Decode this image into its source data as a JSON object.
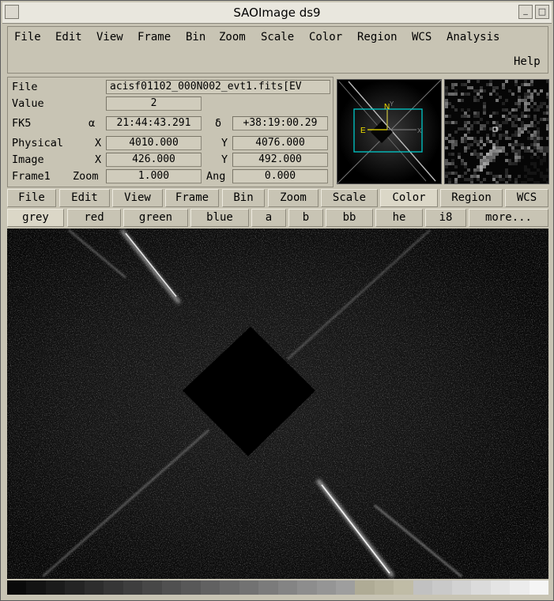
{
  "window": {
    "title": "SAOImage ds9",
    "buttons": {
      "minimize": "_",
      "maximize": "□",
      "close": "✕"
    }
  },
  "menubar": {
    "items": [
      "File",
      "Edit",
      "View",
      "Frame",
      "Bin",
      "Zoom",
      "Scale",
      "Color",
      "Region",
      "WCS",
      "Analysis"
    ],
    "help": "Help"
  },
  "info": {
    "file_label": "File",
    "file_value": "acisf01102_000N002_evt1.fits[EV",
    "value_label": "Value",
    "value_value": "2",
    "fk5_label": "FK5",
    "alpha_symbol": "α",
    "alpha_value": "21:44:43.291",
    "delta_symbol": "δ",
    "delta_value": "+38:19:00.29",
    "physical_label": "Physical",
    "physical_x_label": "X",
    "physical_x": "4010.000",
    "physical_y_label": "Y",
    "physical_y": "4076.000",
    "image_label": "Image",
    "image_x_label": "X",
    "image_x": "426.000",
    "image_y_label": "Y",
    "image_y": "492.000",
    "frame_label": "Frame1",
    "zoom_label": "Zoom",
    "zoom_value": "1.000",
    "ang_label": "Ang",
    "ang_value": "0.000"
  },
  "panner": {
    "north_label": "N",
    "east_label": "E",
    "x_label": "X",
    "y_label": "Y"
  },
  "buttonbar": {
    "items": [
      "File",
      "Edit",
      "View",
      "Frame",
      "Bin",
      "Zoom",
      "Scale",
      "Color",
      "Region",
      "WCS"
    ],
    "active": "Color"
  },
  "colormap_bar": {
    "items": [
      "grey",
      "red",
      "green",
      "blue",
      "a",
      "b",
      "bb",
      "he",
      "i8",
      "more..."
    ],
    "active": "grey"
  },
  "colors": {
    "panner_box": "#00c8c8",
    "compass": "#f0e000",
    "window_bg": "#c8c4b4"
  }
}
